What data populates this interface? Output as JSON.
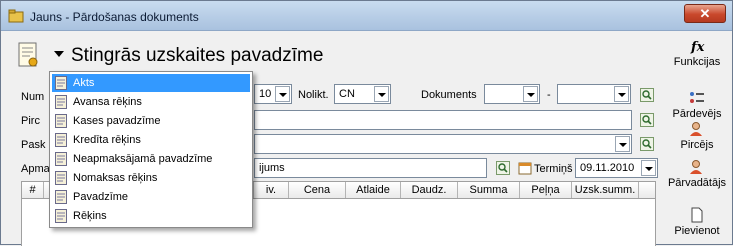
{
  "window": {
    "title": "Jauns - Pārdošanas dokuments",
    "close_label": "✕"
  },
  "header": {
    "doc_type_title": "Stingrās uzskaites pavadzīme"
  },
  "toolbar": {
    "functions_label": "Funkcijas",
    "seller_label": "Pārdevējs",
    "buyer_label": "Pircējs",
    "transporter_label": "Pārvadātājs",
    "attach_label": "Pievienot"
  },
  "form": {
    "number_label": "Num",
    "number_select_value": "10",
    "warehouse_label": "Nolikt.",
    "warehouse_value": "CN",
    "documents_label": "Dokuments",
    "documents_sep": "-",
    "buyer_label": "Pirc",
    "explanation_label": "Pask",
    "payment_label": "Apmal",
    "payment_value": "ijums",
    "term_label": "Termiņš",
    "term_value": "09.11.2010"
  },
  "grid": {
    "columns": [
      "#",
      "",
      "iv.",
      "Cena",
      "Atlaide",
      "Daudz.",
      "Summa",
      "Peļņa",
      "Uzsk.summ."
    ]
  },
  "dropdown": {
    "selected_index": 0,
    "items": [
      "Akts",
      "Avansa rēķins",
      "Kases pavadzīme",
      "Kredīta rēķins",
      "Neapmaksājamā pavadzīme",
      "Nomaksas rēķins",
      "Pavadzīme",
      "Rēķins"
    ]
  }
}
